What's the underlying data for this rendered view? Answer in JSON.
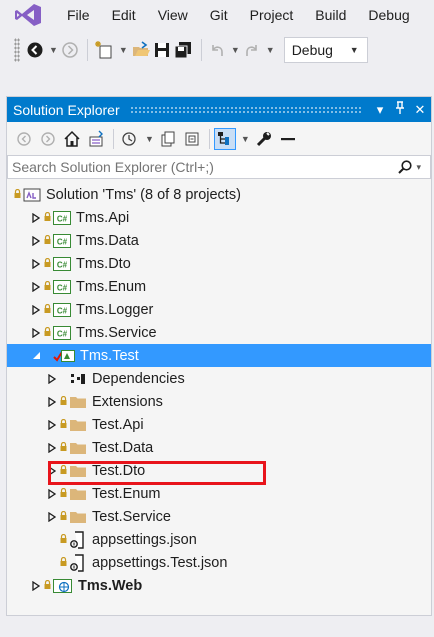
{
  "menubar": {
    "items": [
      "File",
      "Edit",
      "View",
      "Git",
      "Project",
      "Build",
      "Debug"
    ]
  },
  "toolbar": {
    "configuration": "Debug"
  },
  "solution_explorer": {
    "title": "Solution Explorer",
    "search_placeholder": "Search Solution Explorer (Ctrl+;)",
    "tree": [
      {
        "label": "Solution 'Tms' (8 of 8 projects)",
        "icon": "solution-icon",
        "indent": 0,
        "expander": "",
        "lock": true
      },
      {
        "label": "Tms.Api",
        "icon": "csharp-project-icon",
        "indent": 1,
        "expander": "collapsed",
        "lock": true
      },
      {
        "label": "Tms.Data",
        "icon": "csharp-project-icon",
        "indent": 1,
        "expander": "collapsed",
        "lock": true
      },
      {
        "label": "Tms.Dto",
        "icon": "csharp-project-icon",
        "indent": 1,
        "expander": "collapsed",
        "lock": true
      },
      {
        "label": "Tms.Enum",
        "icon": "csharp-project-icon",
        "indent": 1,
        "expander": "collapsed",
        "lock": true
      },
      {
        "label": "Tms.Logger",
        "icon": "csharp-project-icon",
        "indent": 1,
        "expander": "collapsed",
        "lock": true
      },
      {
        "label": "Tms.Service",
        "icon": "csharp-project-icon",
        "indent": 1,
        "expander": "collapsed",
        "lock": true
      },
      {
        "label": "Tms.Test",
        "icon": "test-project-icon",
        "indent": 1,
        "expander": "expanded",
        "lock": false,
        "selected": true
      },
      {
        "label": "Dependencies",
        "icon": "dependencies-icon",
        "indent": 2,
        "expander": "collapsed",
        "lock": false
      },
      {
        "label": "Extensions",
        "icon": "folder-icon",
        "indent": 2,
        "expander": "collapsed",
        "lock": true
      },
      {
        "label": "Test.Api",
        "icon": "folder-icon",
        "indent": 2,
        "expander": "collapsed",
        "lock": true
      },
      {
        "label": "Test.Data",
        "icon": "folder-icon",
        "indent": 2,
        "expander": "collapsed",
        "lock": true
      },
      {
        "label": "Test.Dto",
        "icon": "folder-icon",
        "indent": 2,
        "expander": "collapsed",
        "lock": true
      },
      {
        "label": "Test.Enum",
        "icon": "folder-icon",
        "indent": 2,
        "expander": "collapsed",
        "lock": true
      },
      {
        "label": "Test.Service",
        "icon": "folder-icon",
        "indent": 2,
        "expander": "collapsed",
        "lock": true
      },
      {
        "label": "appsettings.json",
        "icon": "json-file-icon",
        "indent": 2,
        "expander": "",
        "lock": true
      },
      {
        "label": "appsettings.Test.json",
        "icon": "json-file-icon",
        "indent": 2,
        "expander": "",
        "lock": true,
        "highlighted": true
      },
      {
        "label": "Tms.Web",
        "icon": "web-project-icon",
        "indent": 1,
        "expander": "collapsed",
        "lock": true,
        "bold": true
      }
    ]
  },
  "colors": {
    "accent": "#007acc",
    "selection": "#3399ff",
    "highlight_border": "#e8141b"
  }
}
